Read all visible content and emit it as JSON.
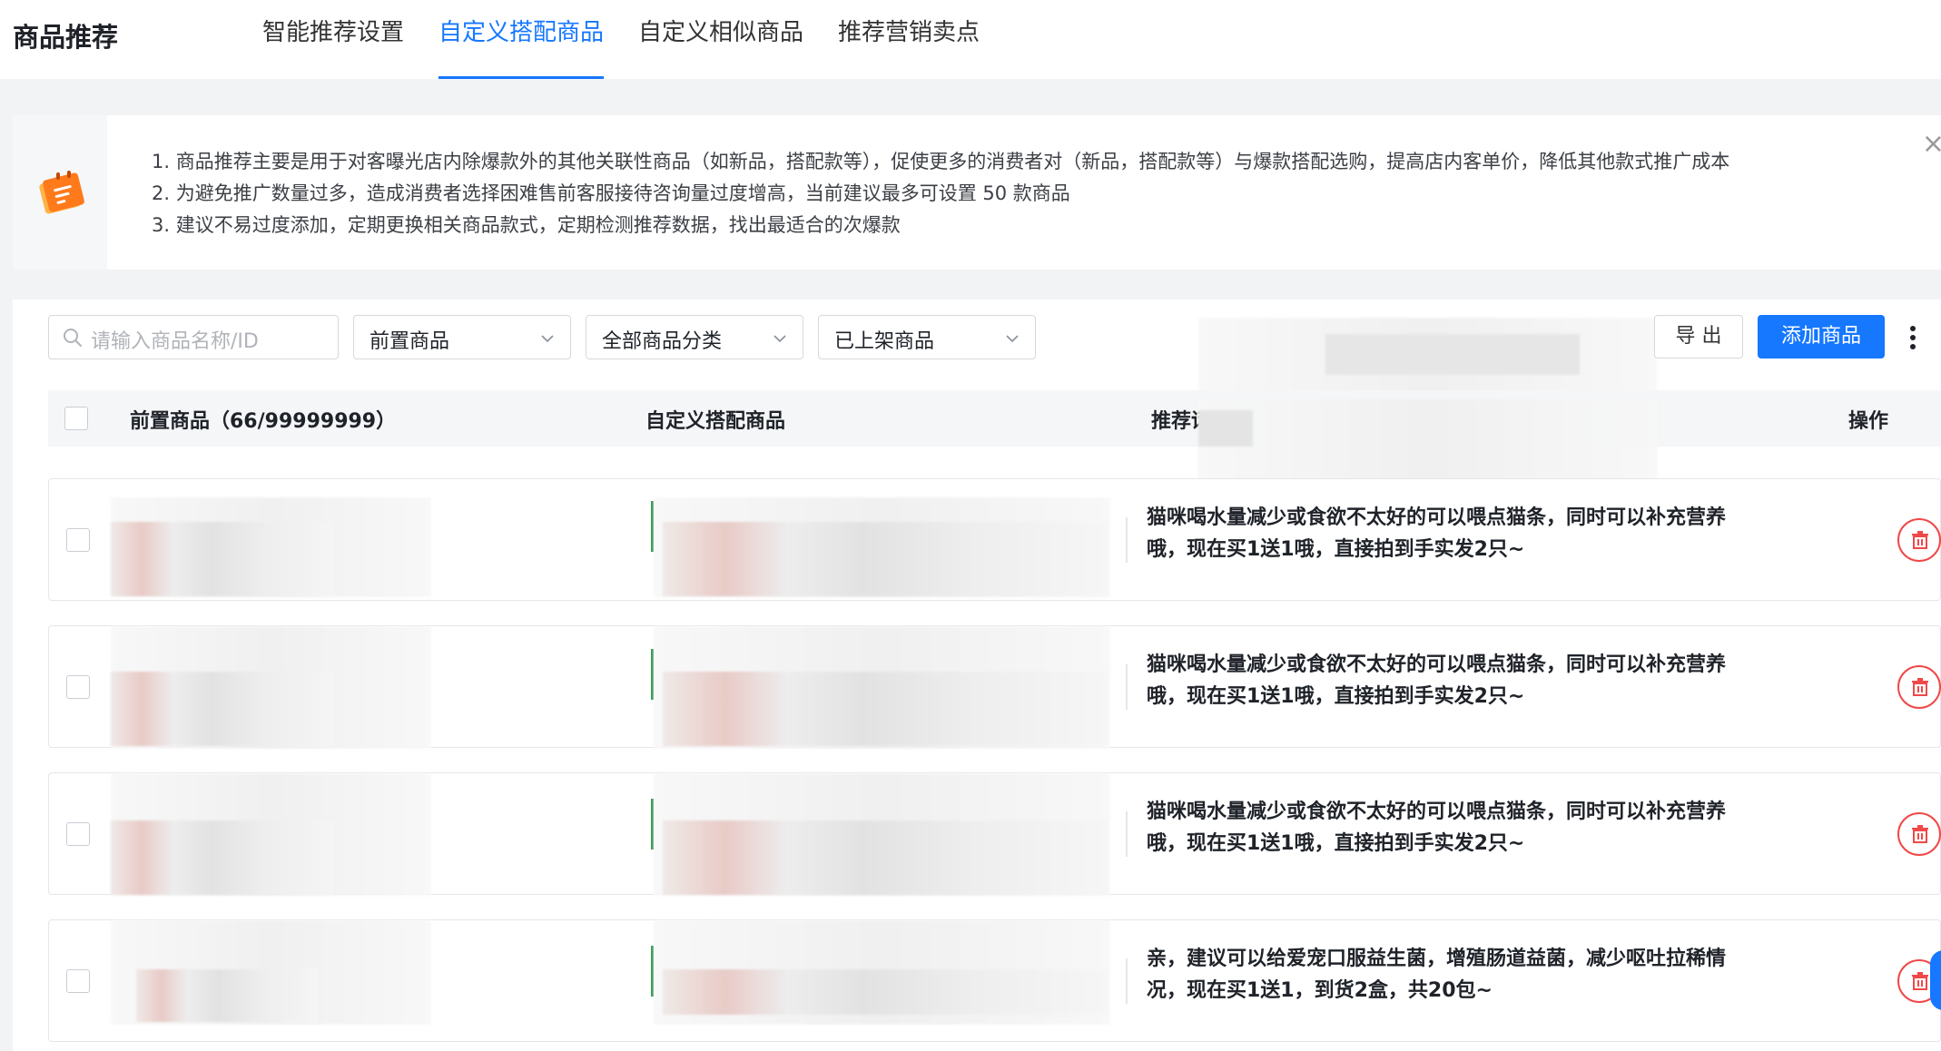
{
  "header": {
    "title": "商品推荐",
    "tabs": [
      {
        "label": "智能推荐设置",
        "active": false
      },
      {
        "label": "自定义搭配商品",
        "active": true
      },
      {
        "label": "自定义相似商品",
        "active": false
      },
      {
        "label": "推荐营销卖点",
        "active": false
      }
    ]
  },
  "notice": {
    "icon": "notepad-icon",
    "lines": [
      "1. 商品推荐主要是用于对客曝光店内除爆款外的其他关联性商品（如新品，搭配款等），促使更多的消费者对（新品，搭配款等）与爆款搭配选购，提高店内客单价，降低其他款式推广成本",
      "2. 为避免推广数量过多，造成消费者选择困难售前客服接待咨询量过度增高，当前建议最多可设置 50 款商品",
      "3. 建议不易过度添加，定期更换相关商品款式，定期检测推荐数据，找出最适合的次爆款"
    ],
    "close_icon": "×"
  },
  "filters": {
    "search_placeholder": "请输入商品名称/ID",
    "select_1": "前置商品",
    "select_2": "全部商品分类",
    "select_3": "已上架商品",
    "export_label": "导 出",
    "add_label": "添加商品"
  },
  "table": {
    "columns": {
      "front": "前置商品（66/99999999）",
      "custom": "自定义搭配商品",
      "recommend": "推荐话",
      "action": "操作"
    },
    "rows": [
      {
        "recommend_text": "猫咪喝水量减少或食欲不太好的可以喂点猫条，同时可以补充营养哦，现在买1送1哦，直接拍到手实发2只~"
      },
      {
        "recommend_text": "猫咪喝水量减少或食欲不太好的可以喂点猫条，同时可以补充营养哦，现在买1送1哦，直接拍到手实发2只~"
      },
      {
        "recommend_text": "猫咪喝水量减少或食欲不太好的可以喂点猫条，同时可以补充营养哦，现在买1送1哦，直接拍到手实发2只~"
      },
      {
        "recommend_text": "亲，建议可以给爱宠口服益生菌，增殖肠道益菌，减少呕吐拉稀情况，现在买1送1，到货2盒，共20包~"
      }
    ]
  },
  "colors": {
    "primary": "#1677ff",
    "danger": "#f04848"
  }
}
